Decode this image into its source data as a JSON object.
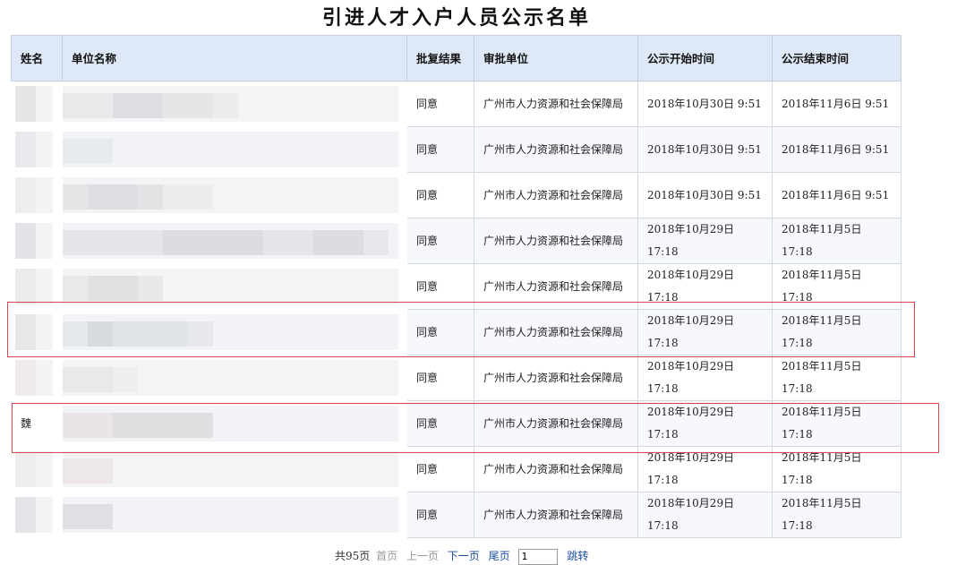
{
  "title": "引进人才入户人员公示名单",
  "columns": {
    "name": "姓名",
    "unit": "单位名称",
    "result": "批复结果",
    "approver": "审批单位",
    "start": "公示开始时间",
    "end": "公示结束时间"
  },
  "rows": [
    {
      "name": "",
      "result": "同意",
      "approver": "广州市人力资源和社会保障局",
      "start": "2018年10月30日  9:51",
      "end": "2018年11月6日  9:51"
    },
    {
      "name": "",
      "result": "同意",
      "approver": "广州市人力资源和社会保障局",
      "start": "2018年10月30日  9:51",
      "end": "2018年11月6日  9:51"
    },
    {
      "name": "",
      "result": "同意",
      "approver": "广州市人力资源和社会保障局",
      "start": "2018年10月30日  9:51",
      "end": "2018年11月6日  9:51"
    },
    {
      "name": "",
      "result": "同意",
      "approver": "广州市人力资源和社会保障局",
      "start": "2018年10月29日 17:18",
      "end": "2018年11月5日 17:18"
    },
    {
      "name": "",
      "result": "同意",
      "approver": "广州市人力资源和社会保障局",
      "start": "2018年10月29日 17:18",
      "end": "2018年11月5日 17:18"
    },
    {
      "name": "",
      "result": "同意",
      "approver": "广州市人力资源和社会保障局",
      "start": "2018年10月29日 17:18",
      "end": "2018年11月5日 17:18"
    },
    {
      "name": "",
      "result": "同意",
      "approver": "广州市人力资源和社会保障局",
      "start": "2018年10月29日 17:18",
      "end": "2018年11月5日 17:18"
    },
    {
      "name": "魏",
      "result": "同意",
      "approver": "广州市人力资源和社会保障局",
      "start": "2018年10月29日 17:18",
      "end": "2018年11月5日 17:18"
    },
    {
      "name": "",
      "result": "同意",
      "approver": "广州市人力资源和社会保障局",
      "start": "2018年10月29日 17:18",
      "end": "2018年11月5日 17:18"
    },
    {
      "name": "",
      "result": "同意",
      "approver": "广州市人力资源和社会保障局",
      "start": "2018年10月29日 17:18",
      "end": "2018年11月5日 17:18"
    }
  ],
  "pager": {
    "total": "共95页",
    "first": "首页",
    "prev": "上一页",
    "next": "下一页",
    "last": "尾页",
    "page_value": "1",
    "go": "跳转"
  },
  "colors": {
    "header_bg": "#dfe8f6",
    "highlight": "#d9464b",
    "link": "#1a4fa0"
  }
}
